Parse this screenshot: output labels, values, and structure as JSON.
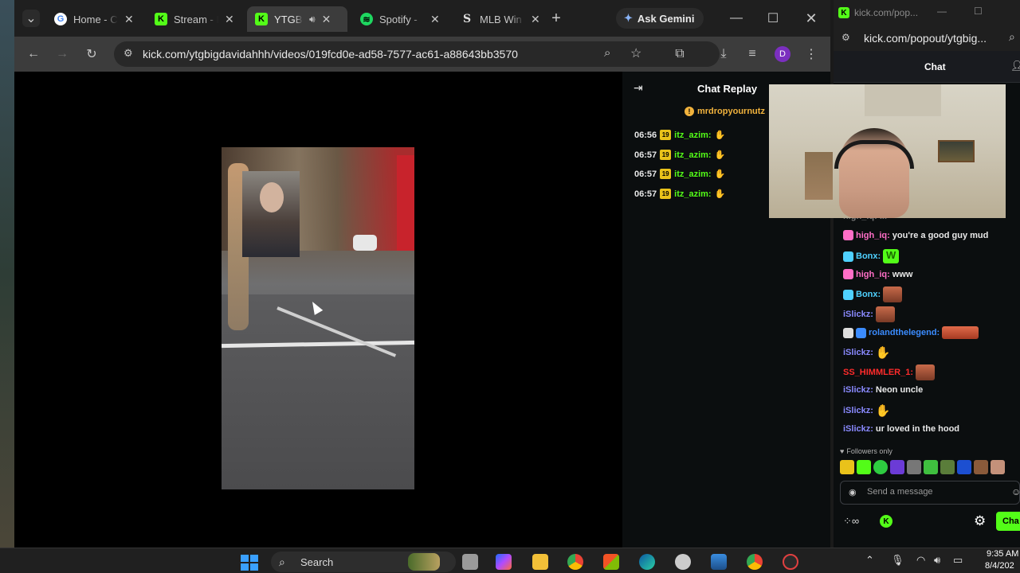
{
  "browser": {
    "tabs": [
      {
        "label": "Home - C",
        "icon": "google-icon",
        "active": false
      },
      {
        "label": "Stream - I",
        "icon": "kick-icon",
        "active": false
      },
      {
        "label": "YTGBi",
        "icon": "kick-icon",
        "active": true
      },
      {
        "label": "Spotify - ",
        "icon": "spotify-icon",
        "active": false
      },
      {
        "label": "MLB Win",
        "icon": "s-icon",
        "active": false
      }
    ],
    "ask_gemini": "Ask Gemini",
    "url": "kick.com/ytgbigdavidahhh/videos/019fcd0e-ad58-7577-ac61-a88643bb3570",
    "profile_initial": "D"
  },
  "chat_replay": {
    "title": "Chat Replay",
    "pinned_user": "mrdropyournutz",
    "messages": [
      {
        "time": "06:56",
        "badge": "19",
        "user": "itz_azim:"
      },
      {
        "time": "06:57",
        "badge": "19",
        "user": "itz_azim:"
      },
      {
        "time": "06:57",
        "badge": "19",
        "user": "itz_azim:"
      },
      {
        "time": "06:57",
        "badge": "19",
        "user": "itz_azim:"
      }
    ]
  },
  "popout": {
    "window_title": "kick.com/pop...",
    "url": "kick.com/popout/ytgbig...",
    "tab_label": "Chat",
    "partial_line": "high_iq: ...",
    "messages": [
      {
        "user": "high_iq:",
        "text": "you're a good guy mud",
        "color": "#ff6ec7"
      },
      {
        "user": "Bonx:",
        "text": "",
        "color": "#4fd1ff",
        "emote": "w"
      },
      {
        "user": "high_iq:",
        "text": "www",
        "color": "#ff6ec7"
      },
      {
        "user": "Bonx:",
        "text": "",
        "color": "#4fd1ff",
        "emote": "face"
      },
      {
        "user": "iSlickz:",
        "text": "",
        "color": "#8a8aff",
        "emote": "face"
      },
      {
        "user": "rolandthelegend:",
        "text": "",
        "color": "#3b8cff",
        "emote": "lips"
      },
      {
        "user": "iSlickz:",
        "text": "",
        "color": "#8a8aff",
        "emote": "hands"
      },
      {
        "user": "SS_HIMMLER_1:",
        "text": "",
        "color": "#ff2b2b",
        "emote": "face"
      },
      {
        "user": "iSlickz:",
        "text": "Neon uncle",
        "color": "#8a8aff"
      },
      {
        "user": "iSlickz:",
        "text": "",
        "color": "#8a8aff",
        "emote": "hands"
      },
      {
        "user": "iSlickz:",
        "text": "ur loved in the hood",
        "color": "#8a8aff"
      }
    ],
    "followers_only": "Followers only",
    "input_placeholder": "Send a message",
    "chat_button": "Cha"
  },
  "taskbar": {
    "search_label": "Search",
    "time": "9:35 AM",
    "date": "8/4/202"
  },
  "colors": {
    "kick_green": "#53fc18",
    "sub_badge": "#e9c21a"
  }
}
